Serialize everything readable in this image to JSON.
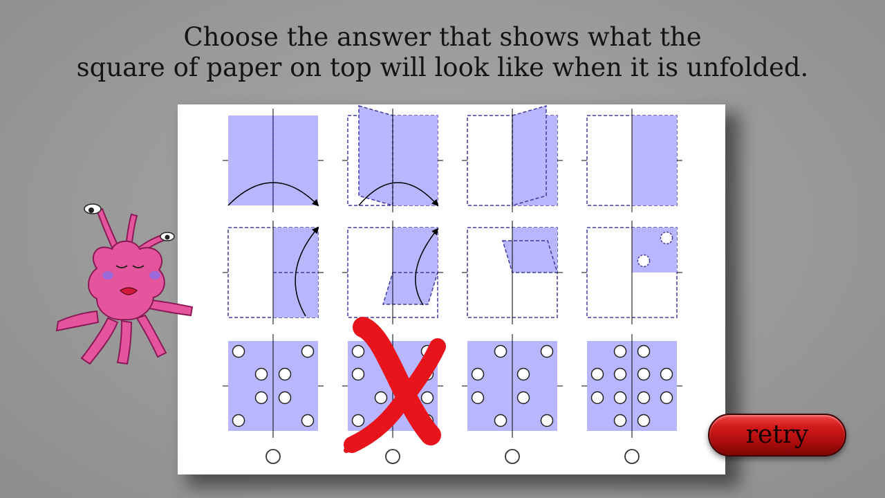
{
  "question": {
    "line1": "Choose the answer that shows what the",
    "line2": "square of paper on top will look like when it is unfolded."
  },
  "retry_label": "retry",
  "answer_count": 4,
  "wrong_answer_index": 1,
  "colors": {
    "paper_fill": "#b7b6ff",
    "dash_line": "#3f3a9e",
    "wrong_mark": "#e8141b",
    "retry_button": "#c41010",
    "mascot": "#e4559e"
  },
  "icons": {
    "wrong": "red-x-mark-icon",
    "fold_arrow": "curved-arrow-icon",
    "hole": "circle-hole-icon",
    "choice": "radio-circle-icon"
  }
}
